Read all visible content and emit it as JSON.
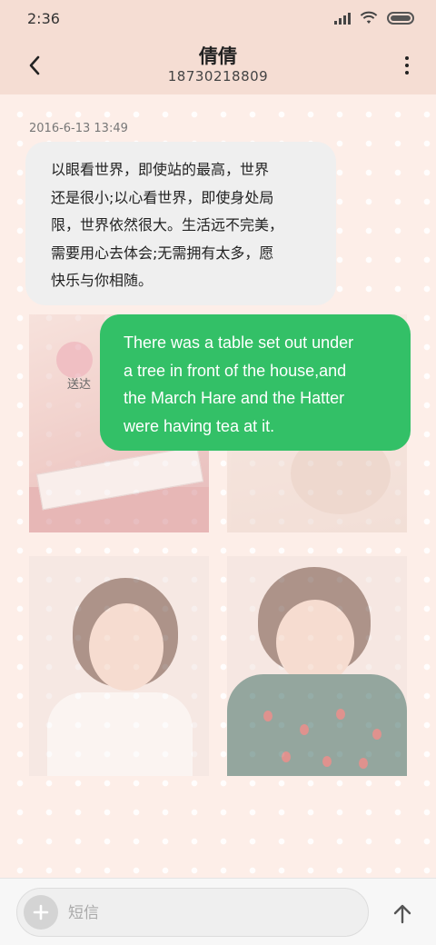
{
  "status_bar": {
    "time": "2:36",
    "icons": [
      "signal-icon",
      "wifi-icon",
      "battery-icon"
    ]
  },
  "header": {
    "title": "倩倩",
    "subtitle": "18730218809",
    "back_icon": "chevron-left-icon",
    "more_icon": "more-vertical-icon"
  },
  "conversation": {
    "timestamp": "2016-6-13 13:49",
    "incoming_message": {
      "lines": [
        "以眼看世界，即使站的最高，世界",
        "还是很小;以心看世界，即使身处局",
        "限，世界依然很大。生活远不完美，",
        "需要用心去体会;无需拥有太多，愿",
        "快乐与你相随。"
      ]
    },
    "outgoing_message": {
      "lines": [
        "There was a table set out under",
        "a tree in front of the house,and",
        "the March Hare and the Hatter",
        "were having tea at it."
      ],
      "status": "送达"
    }
  },
  "composer": {
    "placeholder": "短信",
    "value": "",
    "add_icon": "plus-icon",
    "send_icon": "arrow-up-icon"
  },
  "colors": {
    "header_bg": "#f5ddd3",
    "chat_bg": "#fdeee8",
    "incoming_bubble": "#efefef",
    "outgoing_bubble": "#33c067"
  }
}
